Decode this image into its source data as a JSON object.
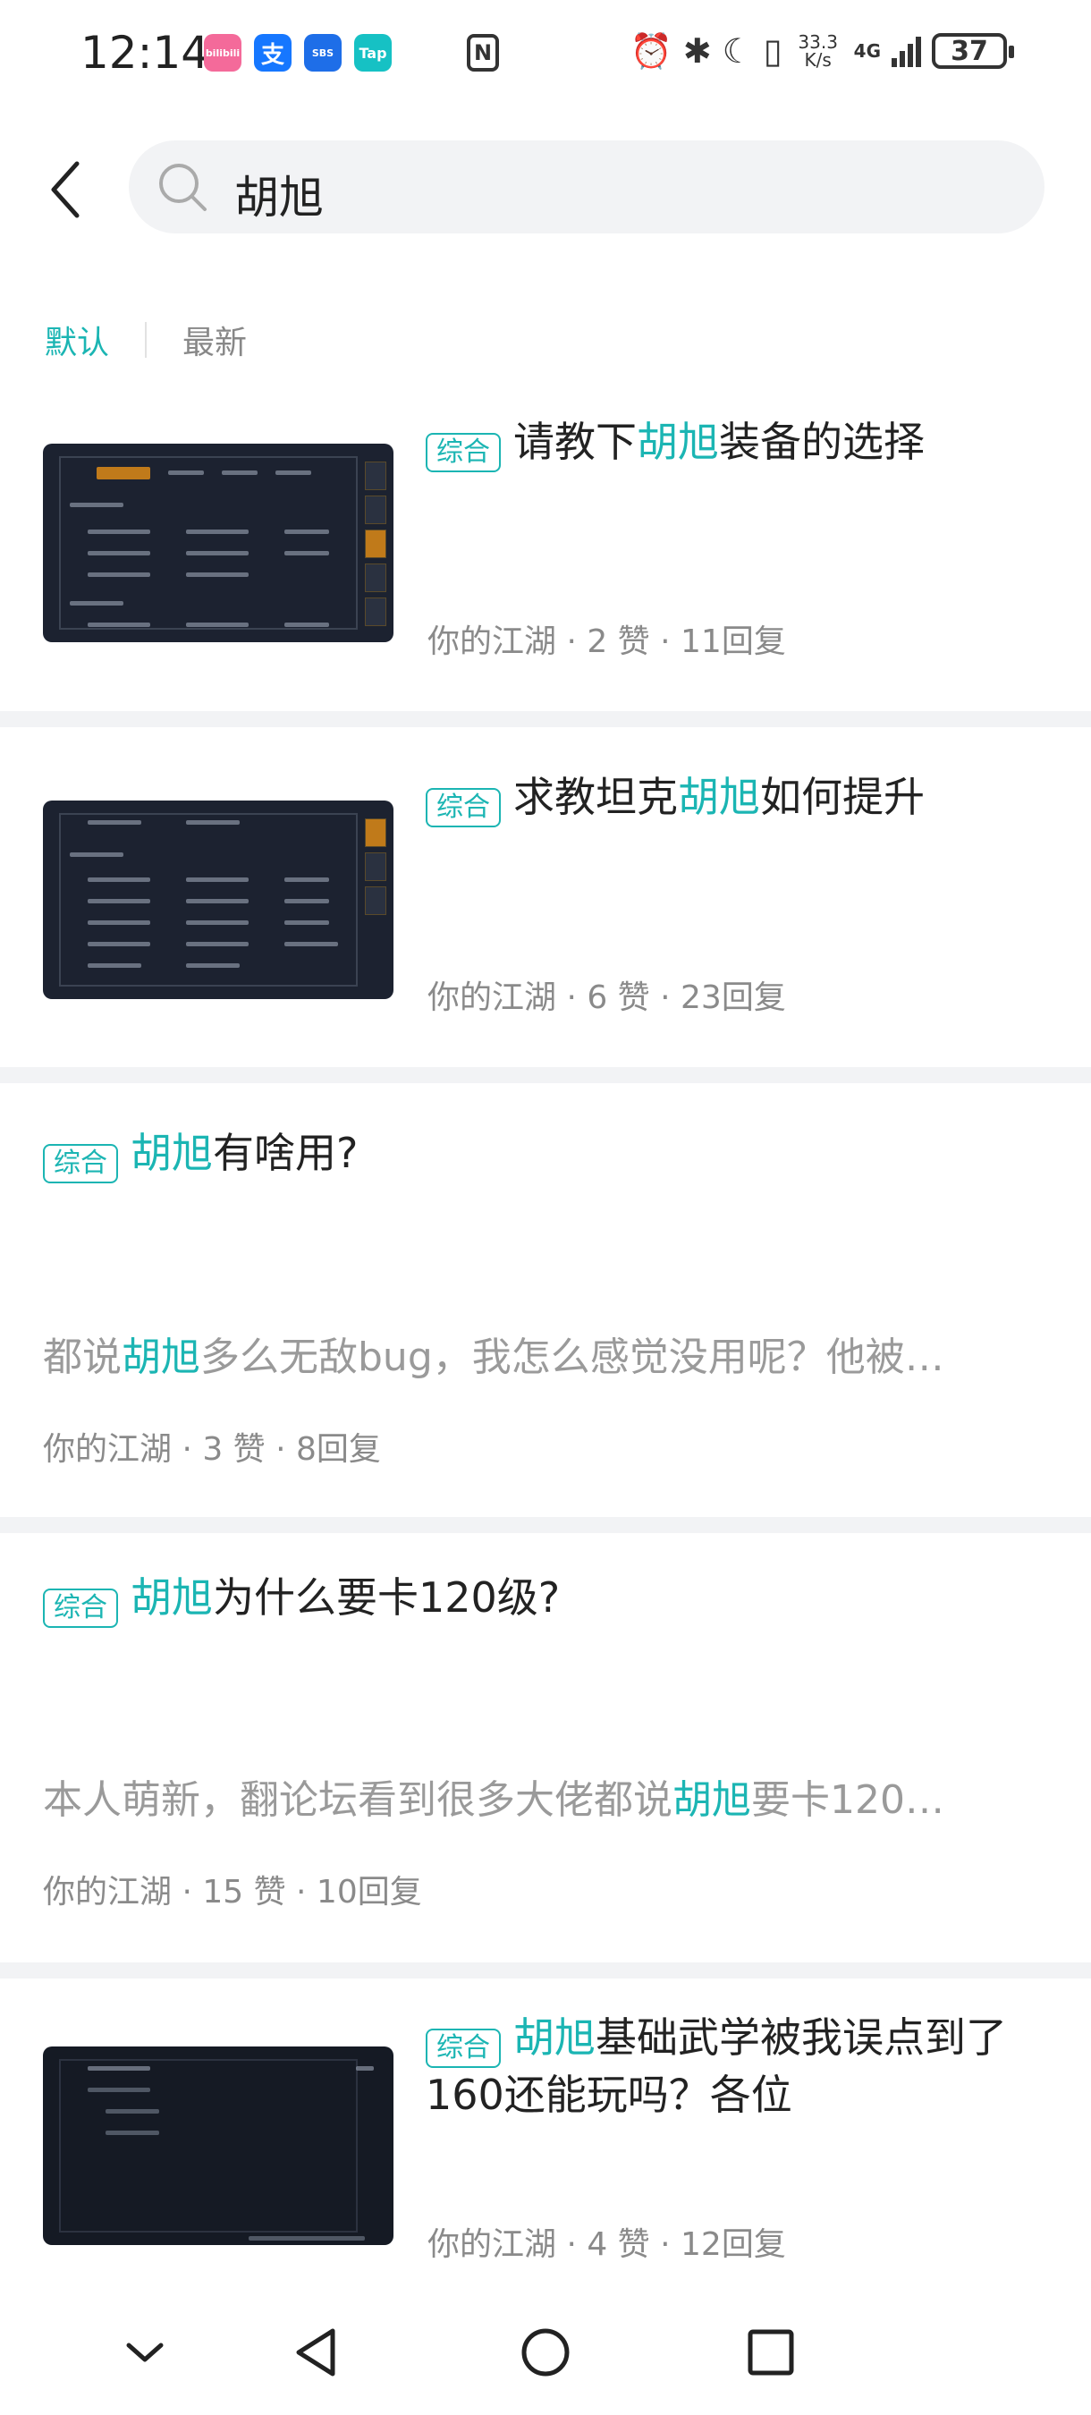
{
  "status_bar": {
    "time": "12:14",
    "apps": [
      {
        "icon": "bilibili-icon",
        "label": "bilibili",
        "color": "#f46a9a"
      },
      {
        "icon": "alipay-icon",
        "label": "支",
        "color": "#1677ff"
      },
      {
        "icon": "app-icon",
        "label": "SBS",
        "color": "#1e6ee8"
      },
      {
        "icon": "taptap-icon",
        "label": "Tap",
        "color": "#16c1c4"
      }
    ],
    "nfc": "N",
    "net_speed_value": "33.3",
    "net_speed_unit": "K/s",
    "network": "4G",
    "battery": "37"
  },
  "search": {
    "query": "胡旭"
  },
  "tabs": [
    {
      "label": "默认",
      "active": true
    },
    {
      "label": "最新",
      "active": false
    }
  ],
  "accent_color": "#1bb5b3",
  "posts": [
    {
      "tag": "综合",
      "title_before": "请教下",
      "keyword": "胡旭",
      "title_after": "装备的选择",
      "meta": "你的江湖 · 2 赞 · 11回复"
    },
    {
      "tag": "综合",
      "title_before": "求教坦克",
      "keyword": "胡旭",
      "title_after": "如何提升",
      "meta": "你的江湖 · 6 赞 · 23回复"
    },
    {
      "tag": "综合",
      "title_before": "",
      "keyword": "胡旭",
      "title_after": "有啥用?",
      "summary_before": "都说",
      "summary_keyword": "胡旭",
      "summary_after": "多么无敌bug，我怎么感觉没用呢？他被…",
      "meta": "你的江湖 · 3 赞 · 8回复"
    },
    {
      "tag": "综合",
      "title_before": "",
      "keyword": "胡旭",
      "title_after": "为什么要卡120级?",
      "summary_before": "本人萌新，翻论坛看到很多大佬都说",
      "summary_keyword": "胡旭",
      "summary_after": "要卡120…",
      "meta": "你的江湖 · 15 赞 · 10回复"
    },
    {
      "tag": "综合",
      "title_before": "",
      "keyword": "胡旭",
      "title_after": "基础武学被我误点到了",
      "title_line2": "160还能玩吗？各位",
      "meta": "你的江湖 · 4 赞 · 12回复"
    }
  ]
}
